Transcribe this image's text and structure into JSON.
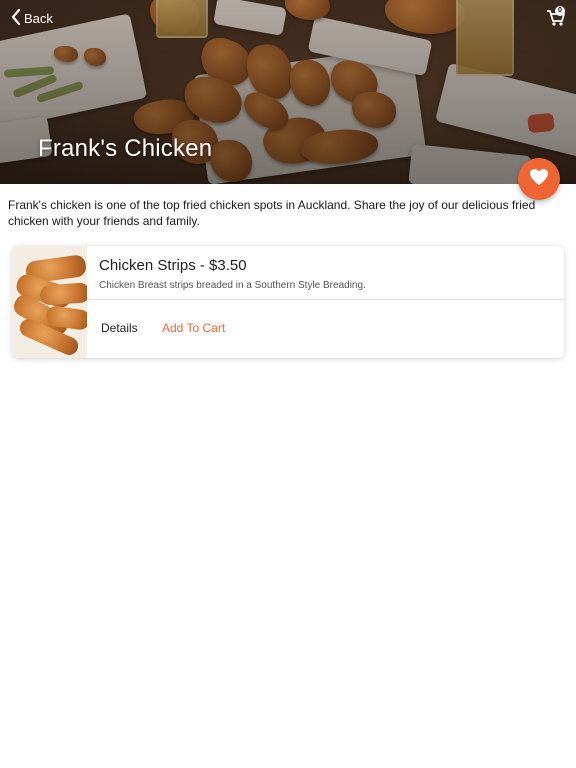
{
  "header": {
    "back_label": "Back",
    "cart_badge": "0",
    "cart_icon": "cart-icon",
    "back_icon": "chevron-left-icon"
  },
  "restaurant": {
    "name": "Frank's Chicken",
    "description": "Frank's chicken is one of the top fried chicken spots in Auckland. Share the joy of our delicious fried chicken with your friends and family.",
    "favorite_icon": "heart-icon"
  },
  "menu_items": [
    {
      "title": "Chicken Strips - $3.50",
      "description": "Chicken Breast strips breaded in a Southern Style Breading.",
      "details_label": "Details",
      "add_to_cart_label": "Add To Cart"
    }
  ],
  "colors": {
    "accent": "#ee6534",
    "text": "#1f1f1f"
  }
}
